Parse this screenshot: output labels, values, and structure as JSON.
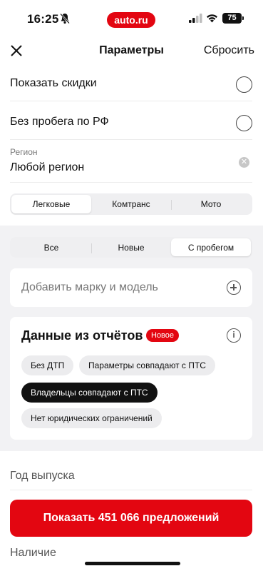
{
  "status_bar": {
    "time": "16:25",
    "brand": "auto.ru",
    "battery": "75",
    "icons": [
      "bell-off-icon",
      "signal-icon",
      "wifi-icon",
      "battery-icon"
    ]
  },
  "header": {
    "close_icon": "close-icon",
    "title": "Параметры",
    "reset_label": "Сбросить"
  },
  "options": {
    "show_discounts": "Показать скидки",
    "no_mileage_rf": "Без пробега по РФ"
  },
  "region": {
    "caption": "Регион",
    "value": "Любой регион"
  },
  "vehicle_types": {
    "items": [
      "Легковые",
      "Комтранс",
      "Мото"
    ],
    "active": "Легковые"
  },
  "condition_tabs": {
    "items": [
      "Все",
      "Новые",
      "С пробегом"
    ],
    "active": "С пробегом"
  },
  "add_make": {
    "label": "Добавить марку и модель"
  },
  "reports": {
    "title": "Данные из отчётов",
    "badge": "Новое",
    "chips": [
      "Без ДТП",
      "Параметры совпадают с ПТС",
      "Владельцы совпадают с ПТС",
      "Нет юридических ограничений"
    ],
    "selected": "Владельцы совпадают с ПТС"
  },
  "year": {
    "label": "Год выпуска"
  },
  "cta": {
    "label": "Показать 451 066 предложений"
  },
  "availability": {
    "label": "Наличие"
  },
  "colors": {
    "accent": "#e30611",
    "segment_bg": "#efeff1",
    "section_bg": "#f2f2f4"
  }
}
